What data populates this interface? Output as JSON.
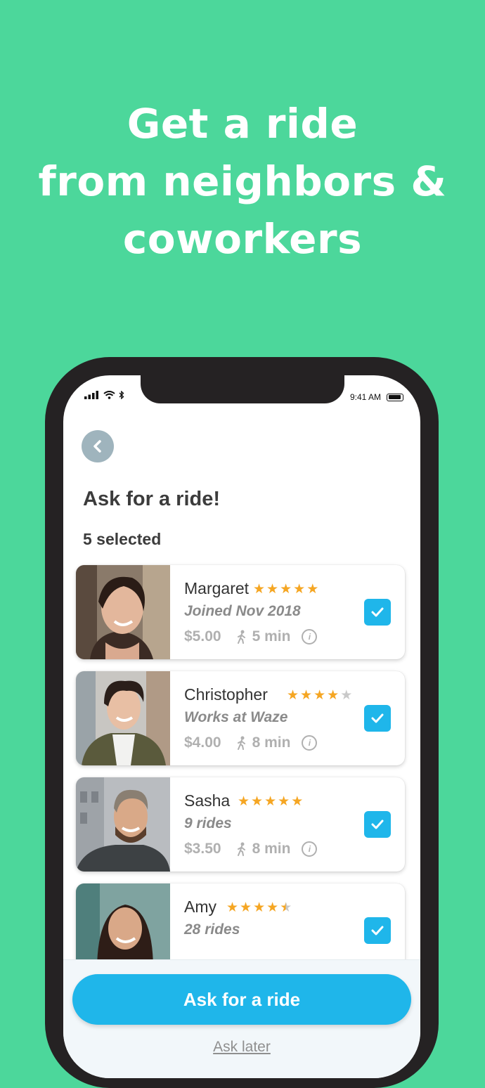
{
  "headline": [
    "Get a ride",
    "from neighbors &",
    "coworkers"
  ],
  "status": {
    "time": "9:41 AM"
  },
  "screen": {
    "back_icon": "chevron-left-icon",
    "title": "Ask for a ride!",
    "selected_count": "5 selected"
  },
  "riders": [
    {
      "name": "Margaret",
      "rating": 5,
      "detail": "Joined Nov 2018",
      "price": "$5.00",
      "walk": "5 min",
      "checked": true
    },
    {
      "name": "Christopher",
      "rating": 4,
      "detail": "Works at Waze",
      "price": "$4.00",
      "walk": "8 min",
      "checked": true
    },
    {
      "name": "Sasha",
      "rating": 5,
      "detail": "9 rides",
      "price": "$3.50",
      "walk": "8 min",
      "checked": true
    },
    {
      "name": "Amy",
      "rating": 4.5,
      "detail": "28 rides",
      "price": "",
      "walk": "",
      "checked": true
    }
  ],
  "actions": {
    "primary": "Ask for a ride",
    "secondary": "Ask later"
  },
  "colors": {
    "background": "#4cd79b",
    "accent": "#1fb6ea",
    "star": "#f5a623"
  }
}
